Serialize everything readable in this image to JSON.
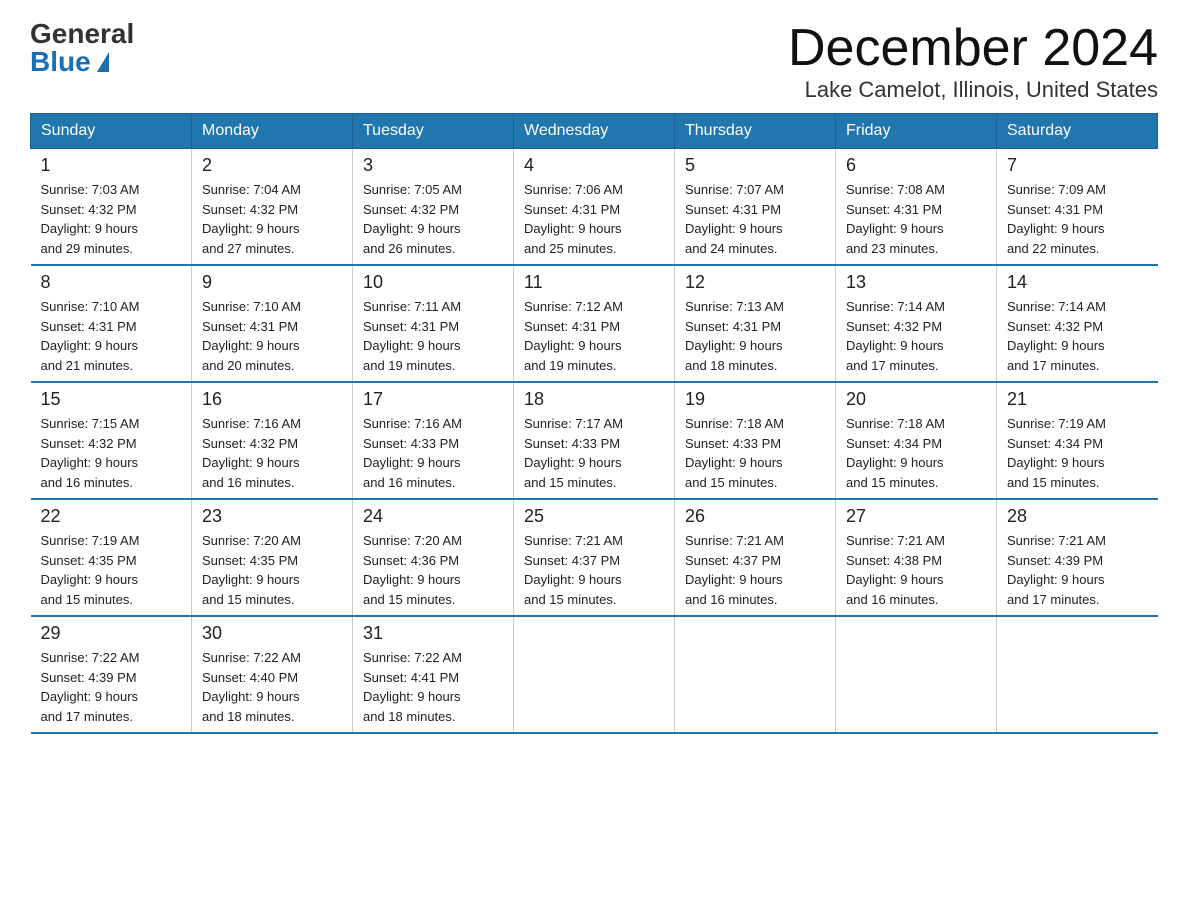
{
  "logo": {
    "general": "General",
    "blue": "Blue"
  },
  "title": "December 2024",
  "location": "Lake Camelot, Illinois, United States",
  "days_of_week": [
    "Sunday",
    "Monday",
    "Tuesday",
    "Wednesday",
    "Thursday",
    "Friday",
    "Saturday"
  ],
  "weeks": [
    [
      {
        "day": "1",
        "sunrise": "7:03 AM",
        "sunset": "4:32 PM",
        "daylight": "9 hours and 29 minutes."
      },
      {
        "day": "2",
        "sunrise": "7:04 AM",
        "sunset": "4:32 PM",
        "daylight": "9 hours and 27 minutes."
      },
      {
        "day": "3",
        "sunrise": "7:05 AM",
        "sunset": "4:32 PM",
        "daylight": "9 hours and 26 minutes."
      },
      {
        "day": "4",
        "sunrise": "7:06 AM",
        "sunset": "4:31 PM",
        "daylight": "9 hours and 25 minutes."
      },
      {
        "day": "5",
        "sunrise": "7:07 AM",
        "sunset": "4:31 PM",
        "daylight": "9 hours and 24 minutes."
      },
      {
        "day": "6",
        "sunrise": "7:08 AM",
        "sunset": "4:31 PM",
        "daylight": "9 hours and 23 minutes."
      },
      {
        "day": "7",
        "sunrise": "7:09 AM",
        "sunset": "4:31 PM",
        "daylight": "9 hours and 22 minutes."
      }
    ],
    [
      {
        "day": "8",
        "sunrise": "7:10 AM",
        "sunset": "4:31 PM",
        "daylight": "9 hours and 21 minutes."
      },
      {
        "day": "9",
        "sunrise": "7:10 AM",
        "sunset": "4:31 PM",
        "daylight": "9 hours and 20 minutes."
      },
      {
        "day": "10",
        "sunrise": "7:11 AM",
        "sunset": "4:31 PM",
        "daylight": "9 hours and 19 minutes."
      },
      {
        "day": "11",
        "sunrise": "7:12 AM",
        "sunset": "4:31 PM",
        "daylight": "9 hours and 19 minutes."
      },
      {
        "day": "12",
        "sunrise": "7:13 AM",
        "sunset": "4:31 PM",
        "daylight": "9 hours and 18 minutes."
      },
      {
        "day": "13",
        "sunrise": "7:14 AM",
        "sunset": "4:32 PM",
        "daylight": "9 hours and 17 minutes."
      },
      {
        "day": "14",
        "sunrise": "7:14 AM",
        "sunset": "4:32 PM",
        "daylight": "9 hours and 17 minutes."
      }
    ],
    [
      {
        "day": "15",
        "sunrise": "7:15 AM",
        "sunset": "4:32 PM",
        "daylight": "9 hours and 16 minutes."
      },
      {
        "day": "16",
        "sunrise": "7:16 AM",
        "sunset": "4:32 PM",
        "daylight": "9 hours and 16 minutes."
      },
      {
        "day": "17",
        "sunrise": "7:16 AM",
        "sunset": "4:33 PM",
        "daylight": "9 hours and 16 minutes."
      },
      {
        "day": "18",
        "sunrise": "7:17 AM",
        "sunset": "4:33 PM",
        "daylight": "9 hours and 15 minutes."
      },
      {
        "day": "19",
        "sunrise": "7:18 AM",
        "sunset": "4:33 PM",
        "daylight": "9 hours and 15 minutes."
      },
      {
        "day": "20",
        "sunrise": "7:18 AM",
        "sunset": "4:34 PM",
        "daylight": "9 hours and 15 minutes."
      },
      {
        "day": "21",
        "sunrise": "7:19 AM",
        "sunset": "4:34 PM",
        "daylight": "9 hours and 15 minutes."
      }
    ],
    [
      {
        "day": "22",
        "sunrise": "7:19 AM",
        "sunset": "4:35 PM",
        "daylight": "9 hours and 15 minutes."
      },
      {
        "day": "23",
        "sunrise": "7:20 AM",
        "sunset": "4:35 PM",
        "daylight": "9 hours and 15 minutes."
      },
      {
        "day": "24",
        "sunrise": "7:20 AM",
        "sunset": "4:36 PM",
        "daylight": "9 hours and 15 minutes."
      },
      {
        "day": "25",
        "sunrise": "7:21 AM",
        "sunset": "4:37 PM",
        "daylight": "9 hours and 15 minutes."
      },
      {
        "day": "26",
        "sunrise": "7:21 AM",
        "sunset": "4:37 PM",
        "daylight": "9 hours and 16 minutes."
      },
      {
        "day": "27",
        "sunrise": "7:21 AM",
        "sunset": "4:38 PM",
        "daylight": "9 hours and 16 minutes."
      },
      {
        "day": "28",
        "sunrise": "7:21 AM",
        "sunset": "4:39 PM",
        "daylight": "9 hours and 17 minutes."
      }
    ],
    [
      {
        "day": "29",
        "sunrise": "7:22 AM",
        "sunset": "4:39 PM",
        "daylight": "9 hours and 17 minutes."
      },
      {
        "day": "30",
        "sunrise": "7:22 AM",
        "sunset": "4:40 PM",
        "daylight": "9 hours and 18 minutes."
      },
      {
        "day": "31",
        "sunrise": "7:22 AM",
        "sunset": "4:41 PM",
        "daylight": "9 hours and 18 minutes."
      },
      null,
      null,
      null,
      null
    ]
  ],
  "labels": {
    "sunrise": "Sunrise:",
    "sunset": "Sunset:",
    "daylight": "Daylight:"
  }
}
